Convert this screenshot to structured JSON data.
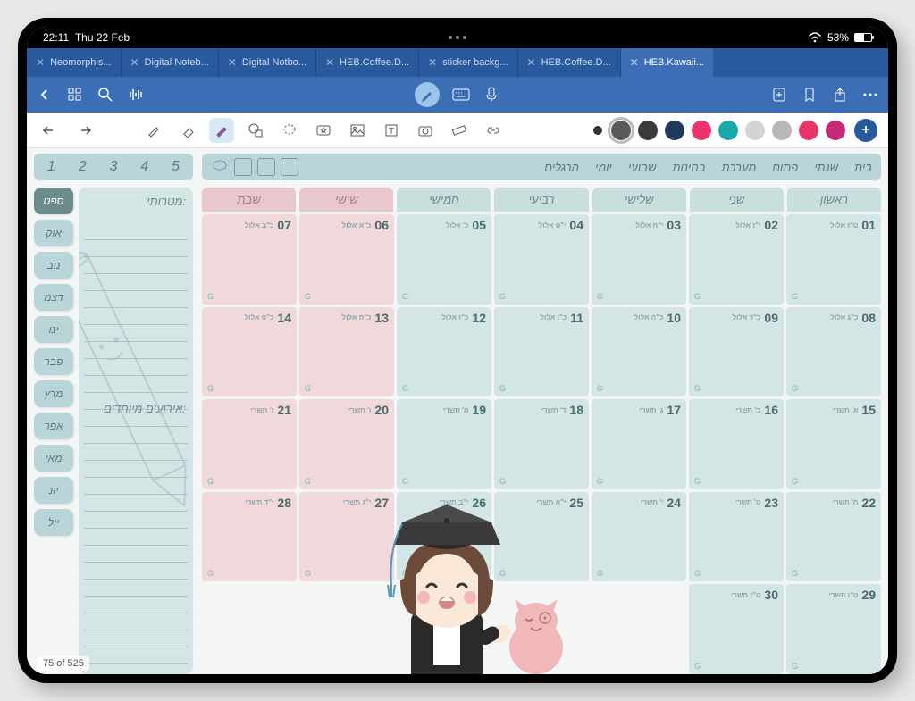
{
  "status": {
    "time": "22:11",
    "date": "Thu 22 Feb",
    "battery": "53%"
  },
  "tabs": [
    {
      "label": "Neomorphis..."
    },
    {
      "label": "Digital Noteb..."
    },
    {
      "label": "Digital Notbo..."
    },
    {
      "label": "HEB.Coffee.D..."
    },
    {
      "label": "sticker backg..."
    },
    {
      "label": "HEB.Coffee.D..."
    },
    {
      "label": "HEB.Kawaii..."
    }
  ],
  "nums": [
    "1",
    "2",
    "3",
    "4",
    "5"
  ],
  "categories": [
    "בית",
    "שנתי",
    "פתוח",
    "מערכת",
    "בחינות",
    "שבועי",
    "יומי",
    "הרגלים"
  ],
  "days": [
    {
      "label": "ראשון",
      "wkend": false
    },
    {
      "label": "שני",
      "wkend": false
    },
    {
      "label": "שלישי",
      "wkend": false
    },
    {
      "label": "רביעי",
      "wkend": false
    },
    {
      "label": "חמישי",
      "wkend": false
    },
    {
      "label": "שישי",
      "wkend": true
    },
    {
      "label": "שבת",
      "wkend": true
    }
  ],
  "months": [
    "ספט",
    "אוק",
    "נוב",
    "דצמ",
    "ינו",
    "פבר",
    "מרץ",
    "אפר",
    "מאי",
    "יונ",
    "יול"
  ],
  "activeMonth": 0,
  "notes": {
    "title": "מטרותי:",
    "sub": "אירועים מיוחדים:"
  },
  "weeks": [
    [
      {
        "n": "01",
        "h": "ט\"ז אלול"
      },
      {
        "n": "02",
        "h": "י\"ז אלול"
      },
      {
        "n": "03",
        "h": "י\"ח אלול"
      },
      {
        "n": "04",
        "h": "י\"ט אלול"
      },
      {
        "n": "05",
        "h": "כ' אלול"
      },
      {
        "n": "06",
        "h": "כ\"א אלול",
        "w": true
      },
      {
        "n": "07",
        "h": "כ\"ב אלול",
        "w": true
      }
    ],
    [
      {
        "n": "08",
        "h": "כ\"ג אלול"
      },
      {
        "n": "09",
        "h": "כ\"ד אלול"
      },
      {
        "n": "10",
        "h": "כ\"ה אלול"
      },
      {
        "n": "11",
        "h": "כ\"ו אלול"
      },
      {
        "n": "12",
        "h": "כ\"ז אלול"
      },
      {
        "n": "13",
        "h": "כ\"ח אלול",
        "w": true
      },
      {
        "n": "14",
        "h": "כ\"ט אלול",
        "w": true
      }
    ],
    [
      {
        "n": "15",
        "h": "א' תשרי"
      },
      {
        "n": "16",
        "h": "ב' תשרי"
      },
      {
        "n": "17",
        "h": "ג' תשרי"
      },
      {
        "n": "18",
        "h": "ד' תשרי"
      },
      {
        "n": "19",
        "h": "ה' תשרי"
      },
      {
        "n": "20",
        "h": "ו' תשרי",
        "w": true
      },
      {
        "n": "21",
        "h": "ז' תשרי",
        "w": true
      }
    ],
    [
      {
        "n": "22",
        "h": "ח' תשרי"
      },
      {
        "n": "23",
        "h": "ט' תשרי"
      },
      {
        "n": "24",
        "h": "י' תשרי"
      },
      {
        "n": "25",
        "h": "י\"א תשרי"
      },
      {
        "n": "26",
        "h": "י\"ב תשרי"
      },
      {
        "n": "27",
        "h": "י\"ג תשרי",
        "w": true
      },
      {
        "n": "28",
        "h": "י\"ד תשרי",
        "w": true
      }
    ],
    [
      {
        "n": "29",
        "h": "ט\"ו תשרי"
      },
      {
        "n": "30",
        "h": "ט\"ז תשרי"
      },
      {
        "e": true
      },
      {
        "e": true
      },
      {
        "e": true
      },
      {
        "e": true
      },
      {
        "e": true
      }
    ]
  ],
  "colors": [
    "#5a5a5a",
    "#3a3a3a",
    "#1e3a5a",
    "#e8336b",
    "#1aa8a8",
    "#d4d4d4",
    "#b8b8b8",
    "#e8336b",
    "#c82878"
  ],
  "selectedColor": 0,
  "pageCount": "75 of 525"
}
